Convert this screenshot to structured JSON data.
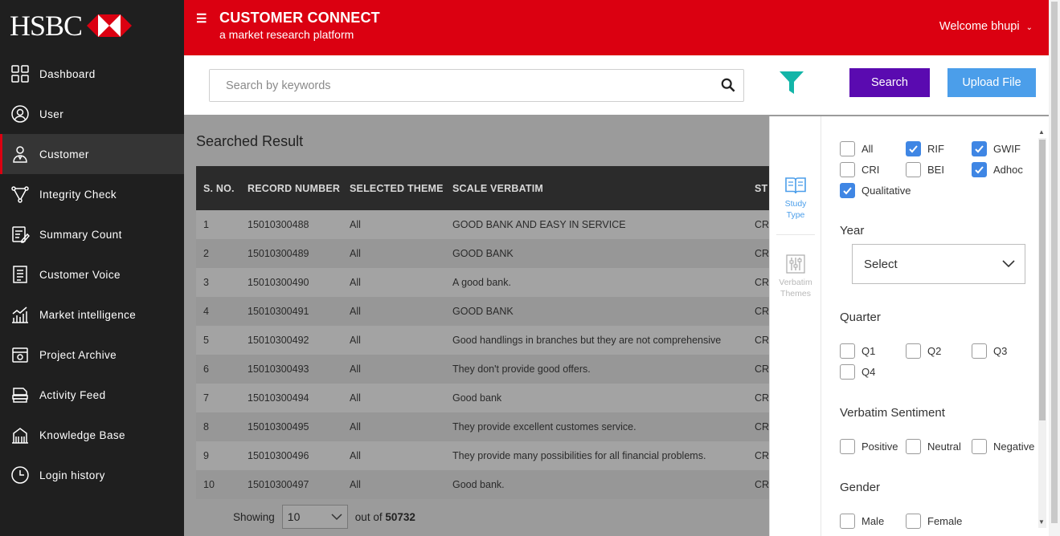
{
  "brand": {
    "logo_text": "HSBC",
    "accent": "#db0011"
  },
  "sidebar": {
    "items": [
      {
        "label": "Dashboard",
        "icon": "dashboard-icon"
      },
      {
        "label": "User",
        "icon": "user-icon"
      },
      {
        "label": "Customer",
        "icon": "customer-icon",
        "active": true
      },
      {
        "label": "Integrity Check",
        "icon": "integrity-check-icon"
      },
      {
        "label": "Summary Count",
        "icon": "summary-count-icon"
      },
      {
        "label": "Customer Voice",
        "icon": "customer-voice-icon"
      },
      {
        "label": "Market intelligence",
        "icon": "market-intelligence-icon"
      },
      {
        "label": "Project Archive",
        "icon": "project-archive-icon"
      },
      {
        "label": "Activity Feed",
        "icon": "activity-feed-icon"
      },
      {
        "label": "Knowledge Base",
        "icon": "knowledge-base-icon"
      },
      {
        "label": "Login history",
        "icon": "login-history-icon"
      }
    ]
  },
  "header": {
    "title": "CUSTOMER CONNECT",
    "subtitle": "a market research platform",
    "welcome": "Welcome bhupi"
  },
  "toolbar": {
    "search_placeholder": "Search by keywords",
    "search_label": "Search",
    "upload_label": "Upload File",
    "filter_color": "#13b5a8",
    "search_button_color": "#5a0ab0",
    "upload_button_color": "#4b9eea"
  },
  "results": {
    "title": "Searched Result",
    "columns": [
      "S. NO.",
      "RECORD NUMBER",
      "SELECTED THEME",
      "SCALE VERBATIM",
      "STUDY"
    ],
    "rows": [
      [
        "1",
        "15010300488",
        "All",
        "GOOD BANK AND EASY IN SERVICE",
        "CR"
      ],
      [
        "2",
        "15010300489",
        "All",
        "GOOD BANK",
        "CR"
      ],
      [
        "3",
        "15010300490",
        "All",
        "A good bank.",
        "CR"
      ],
      [
        "4",
        "15010300491",
        "All",
        "GOOD BANK",
        "CR"
      ],
      [
        "5",
        "15010300492",
        "All",
        "Good handlings in branches but they are not comprehensive",
        "CR"
      ],
      [
        "6",
        "15010300493",
        "All",
        "They don't provide good offers.",
        "CR"
      ],
      [
        "7",
        "15010300494",
        "All",
        "Good bank",
        "CR"
      ],
      [
        "8",
        "15010300495",
        "All",
        "They provide excellent customes service.",
        "CR"
      ],
      [
        "9",
        "15010300496",
        "All",
        "They provide many possibilities for all financial problems.",
        "CR"
      ],
      [
        "10",
        "15010300497",
        "All",
        "Good bank.",
        "CR"
      ]
    ],
    "pager": {
      "showing_label": "Showing",
      "page_size": "10",
      "out_of_label": "out of",
      "total": "50732"
    }
  },
  "filter_panel": {
    "tabs": [
      {
        "label": "Study Type",
        "line1": "Study",
        "line2": "Type",
        "icon": "book-icon",
        "active": true
      },
      {
        "label": "Verbatim Themes",
        "line1": "Verbatim",
        "line2": "Themes",
        "icon": "sliders-icon",
        "active": false
      }
    ],
    "study_types": [
      {
        "label": "All",
        "checked": false
      },
      {
        "label": "RIF",
        "checked": true
      },
      {
        "label": "GWIF",
        "checked": true
      },
      {
        "label": "CRI",
        "checked": false
      },
      {
        "label": "BEI",
        "checked": false
      },
      {
        "label": "Adhoc",
        "checked": true
      },
      {
        "label": "Qualitative",
        "checked": true
      }
    ],
    "year": {
      "label": "Year",
      "selected": "Select"
    },
    "quarter": {
      "label": "Quarter",
      "options": [
        "Q1",
        "Q2",
        "Q3",
        "Q4"
      ]
    },
    "sentiment": {
      "label": "Verbatim Sentiment",
      "options": [
        "Positive",
        "Neutral",
        "Negative"
      ]
    },
    "gender": {
      "label": "Gender",
      "options": [
        "Male",
        "Female"
      ]
    }
  }
}
